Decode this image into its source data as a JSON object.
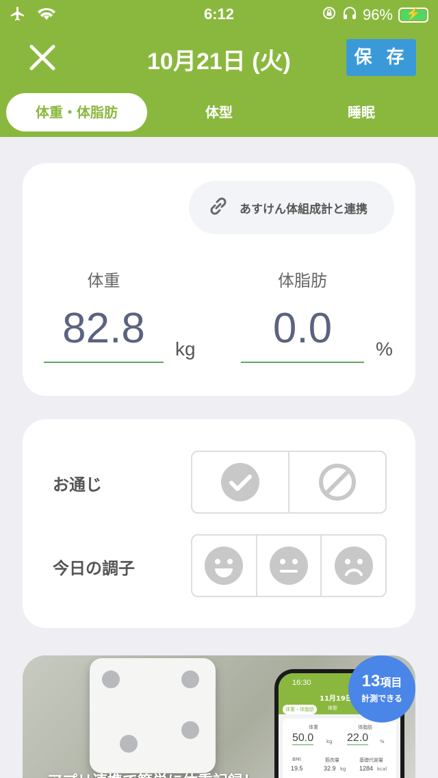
{
  "status_bar": {
    "time": "6:12",
    "battery_percent": "96%",
    "airplane_mode": true,
    "wifi": true,
    "headphones": true,
    "charging": true
  },
  "header": {
    "title": "10月21日 (火)",
    "save_label": "保 存"
  },
  "tabs": [
    {
      "label": "体重・体脂肪",
      "active": true
    },
    {
      "label": "体型",
      "active": false
    },
    {
      "label": "睡眠",
      "active": false
    }
  ],
  "measure_card": {
    "link_button_label": "あすけん体組成計と連携",
    "weight": {
      "label": "体重",
      "value": "82.8",
      "unit": "kg"
    },
    "body_fat": {
      "label": "体脂肪",
      "value": "0.0",
      "unit": "%"
    }
  },
  "condition_card": {
    "bowel": {
      "label": "お通じ",
      "options": [
        "check-icon",
        "prohibited-icon"
      ]
    },
    "mood": {
      "label": "今日の調子",
      "options": [
        "smile-face-icon",
        "neutral-face-icon",
        "sad-face-icon"
      ]
    }
  },
  "banner": {
    "badge_count": "13",
    "badge_unit": "項目",
    "badge_sub": "計測できる",
    "caption": "アプリ連携で簡単に体重記録！",
    "phone": {
      "time": "16:30",
      "date": "11月19日(",
      "tab_active": "体重・体脂肪",
      "tab_other": "体型",
      "weight_label": "体重",
      "weight_value": "50.0",
      "weight_unit": "kg",
      "fat_label": "体脂肪",
      "fat_value": "22.0",
      "fat_unit": "%",
      "stats": [
        {
          "label": "BMI",
          "value": "19.5",
          "unit": ""
        },
        {
          "label": "筋肉量",
          "value": "32.9",
          "unit": "kg"
        },
        {
          "label": "基礎代謝量",
          "value": "1284",
          "unit": "kcal"
        }
      ]
    }
  },
  "colors": {
    "brand_green": "#8ab83e",
    "save_blue": "#3a9ad9",
    "badge_blue": "#4a86e8",
    "underline_green": "#59a85a"
  }
}
